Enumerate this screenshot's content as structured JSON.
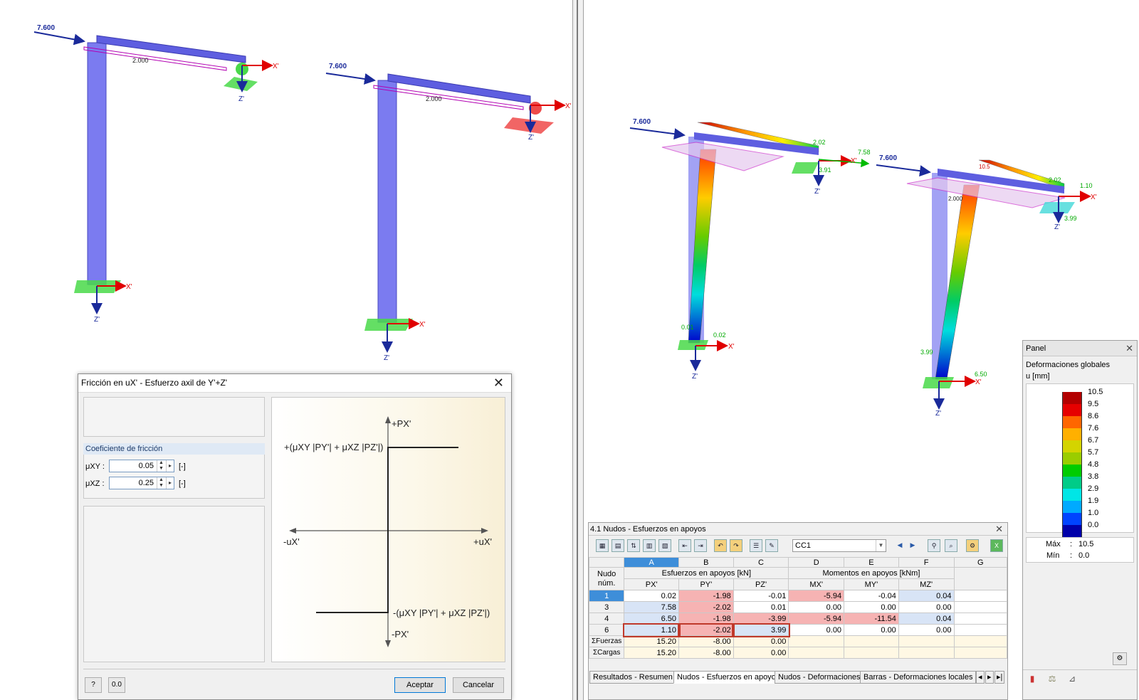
{
  "viewports": {
    "left_model_1": {
      "load_label": "7.600",
      "dim_label": "2.000",
      "axis_x": "X'",
      "axis_z": "Z'"
    },
    "left_model_2": {
      "load_label": "7.600",
      "dim_label": "2.000",
      "axis_x": "X'",
      "axis_z": "Z'"
    },
    "right_model_1": {
      "load_label": "7.600",
      "label_top": "2.02",
      "label_right": "7.58",
      "label_support": "3.91",
      "label_base1": "0.01",
      "label_base2": "0.02",
      "axis_x": "X'",
      "axis_z": "Z'"
    },
    "right_model_2": {
      "load_label": "7.600",
      "label_top": "2.02",
      "label_right": "1.10",
      "label_support": "3.99",
      "label_dim": "2.000",
      "label_base_left": "3.99",
      "label_base_right": "6.50",
      "label_peak": "10.5",
      "axis_x": "X'",
      "axis_z": "Z'"
    }
  },
  "dialog": {
    "title": "Fricción en uX' - Esfuerzo axil de Y'+Z'",
    "group_label": "Coeficiente de fricción",
    "mu_xy_label": "μXY :",
    "mu_xy_value": "0.05",
    "mu_xz_label": "μXZ :",
    "mu_xz_value": "0.25",
    "unit": "[-]",
    "ok_label": "Aceptar",
    "cancel_label": "Cancelar",
    "diagram": {
      "px_pos": "+PX'",
      "px_neg": "-PX'",
      "ux_neg": "-uX'",
      "ux_pos": "+uX'",
      "upper_expr": "+(μXY |PY'| + μXZ |PZ'|)",
      "lower_expr": "-(μXY |PY'| + μXZ |PZ'|)"
    }
  },
  "results": {
    "title": "4.1 Nudos - Esfuerzos en apoyos",
    "load_case": "CC1",
    "col_letters": [
      "A",
      "B",
      "C",
      "D",
      "E",
      "F",
      "G"
    ],
    "header_node": "Nudo núm.",
    "group_forces": "Esfuerzos en apoyos [kN]",
    "group_moments": "Momentos en apoyos [kNm]",
    "sub_headers": [
      "PX'",
      "PY'",
      "PZ'",
      "MX'",
      "MY'",
      "MZ'"
    ],
    "rows": [
      {
        "node": "1",
        "px": "0.02",
        "py": "-1.98",
        "pz": "-0.01",
        "mx": "-5.94",
        "my": "-0.04",
        "mz": "0.04"
      },
      {
        "node": "3",
        "px": "7.58",
        "py": "-2.02",
        "pz": "0.01",
        "mx": "0.00",
        "my": "0.00",
        "mz": "0.00"
      },
      {
        "node": "4",
        "px": "6.50",
        "py": "-1.98",
        "pz": "-3.99",
        "mx": "-5.94",
        "my": "-11.54",
        "mz": "0.04"
      },
      {
        "node": "6",
        "px": "1.10",
        "py": "-2.02",
        "pz": "3.99",
        "mx": "0.00",
        "my": "0.00",
        "mz": "0.00"
      }
    ],
    "sum_rows": [
      {
        "label": "ΣFuerzas",
        "px": "15.20",
        "py": "-8.00",
        "pz": "0.00"
      },
      {
        "label": "ΣCargas",
        "px": "15.20",
        "py": "-8.00",
        "pz": "0.00"
      }
    ],
    "tabs": [
      "Resultados - Resumen",
      "Nudos - Esfuerzos en apoyos",
      "Nudos - Deformaciones",
      "Barras - Deformaciones locales"
    ]
  },
  "panel": {
    "title": "Panel",
    "heading": "Deformaciones globales",
    "unit": "u [mm]",
    "legend": [
      {
        "value": "10.5",
        "color": "#b30000"
      },
      {
        "value": "9.5",
        "color": "#e60000"
      },
      {
        "value": "8.6",
        "color": "#ff6600"
      },
      {
        "value": "7.6",
        "color": "#ffb000"
      },
      {
        "value": "6.7",
        "color": "#d4d400"
      },
      {
        "value": "5.7",
        "color": "#9acd00"
      },
      {
        "value": "4.8",
        "color": "#00cc00"
      },
      {
        "value": "3.8",
        "color": "#00cc88"
      },
      {
        "value": "2.9",
        "color": "#00e6e6"
      },
      {
        "value": "1.9",
        "color": "#00aaff"
      },
      {
        "value": "1.0",
        "color": "#0044ff"
      },
      {
        "value": "0.0",
        "color": "#0000aa"
      }
    ],
    "max_label": "Máx",
    "max_value": "10.5",
    "min_label": "Mín",
    "min_value": "0.0"
  }
}
